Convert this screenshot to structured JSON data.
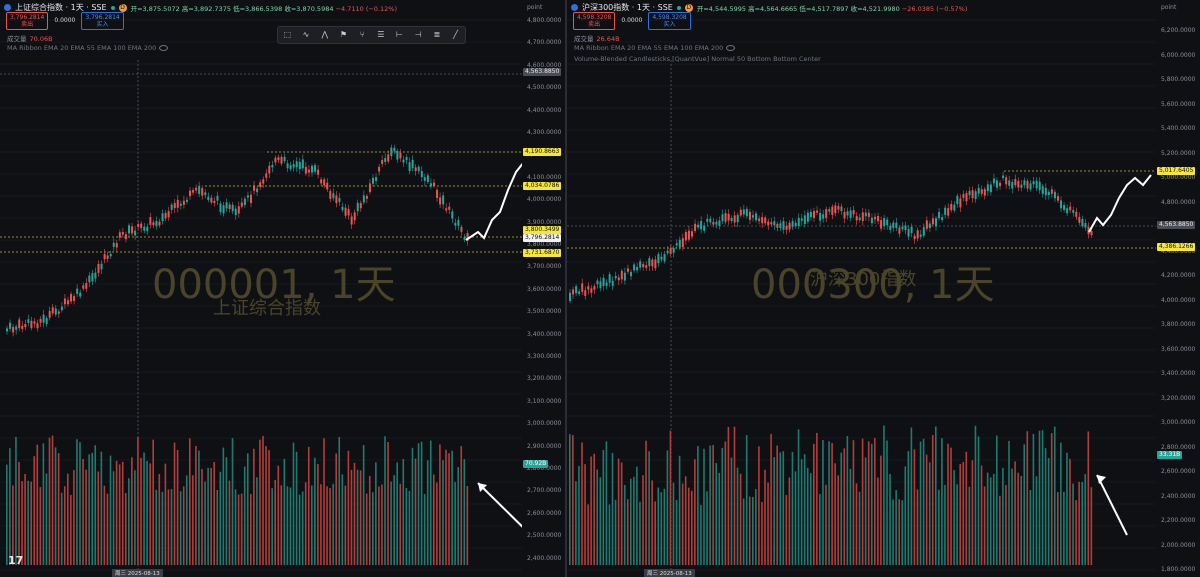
{
  "left": {
    "symbol_title": "上证综合指数 · 1天 · SSE",
    "ohlc": {
      "open": "开=3,875.5072",
      "high": "高=3,892.7375",
      "low": "低=3,866.5398",
      "close": "收=3,870.5984",
      "change": "−4.7110 (−0.12%)"
    },
    "sell_price": "3,796.2814",
    "sell_label": "卖出",
    "spread": "0.0000",
    "buy_price": "3,796.2814",
    "buy_label": "买入",
    "volume_label": "成交量",
    "volume_value": "70.06B",
    "indicator_ma": "MA Ribbon EMA 20 EMA 55 EMA 100 EMA 200",
    "watermark_symbol": "000001, 1天",
    "watermark_name": "上证综合指数",
    "axis_unit": "point",
    "axis_ticks": [
      "4,800.0000",
      "4,700.0000",
      "4,600.0000",
      "4,500.0000",
      "4,400.0000",
      "4,300.0000",
      "4,200.0000",
      "4,100.0000",
      "4,000.0000",
      "3,900.0000",
      "3,800.0000",
      "3,700.0000",
      "3,600.0000",
      "3,500.0000",
      "3,400.0000",
      "3,300.0000",
      "3,200.0000",
      "3,100.0000",
      "3,000.0000",
      "2,900.0000",
      "2,800.0000",
      "2,700.0000",
      "2,600.0000",
      "2,500.0000",
      "2,400.0000",
      "2,300.0000"
    ],
    "tags": {
      "crosshair": "4,563.8850",
      "level_high": "4,190.8663",
      "level_mid": "4,034.0786",
      "level_support": "3,800.3499",
      "last_price": "3,796.2814",
      "level_low": "3,731.6870",
      "volume": "70.92B"
    },
    "date_cursor": "周三 2025-08-13"
  },
  "right": {
    "symbol_title": "沪深300指数 · 1天 · SSE",
    "ohlc": {
      "open": "开=4,544.5995",
      "high": "高=4,564.6665",
      "low": "低=4,517.7897",
      "close": "收=4,521.9980",
      "change": "−26.0385 (−0.57%)"
    },
    "sell_price": "4,598.3208",
    "sell_label": "卖出",
    "spread": "0.0000",
    "buy_price": "4,598.3208",
    "buy_label": "买入",
    "volume_label": "成交量",
    "volume_value": "26.64B",
    "indicator_ma": "MA Ribbon EMA 20 EMA 55 EMA 100 EMA 200",
    "indicator_vbc": "Volume-Blended Candlesticks [QuantVue] Normal 50 Bottom Bottom Center",
    "watermark_symbol": "000300, 1天",
    "watermark_name": "沪深300指数",
    "axis_unit": "point",
    "axis_ticks": [
      "6,200.0000",
      "6,000.0000",
      "5,800.0000",
      "5,600.0000",
      "5,400.0000",
      "5,200.0000",
      "5,000.0000",
      "4,800.0000",
      "4,600.0000",
      "4,400.0000",
      "4,200.0000",
      "4,000.0000",
      "3,800.0000",
      "3,600.0000",
      "3,400.0000",
      "3,200.0000",
      "3,000.0000",
      "2,800.0000",
      "2,600.0000",
      "2,400.0000",
      "2,200.0000",
      "2,000.0000",
      "1,800.0000"
    ],
    "tags": {
      "level_high": "5,017.6405",
      "crosshair": "4,563.8850",
      "level_low": "4,386.1266",
      "volume": "33.31B"
    },
    "date_cursor": "周三 2025-08-13"
  },
  "colors": {
    "up": "#26a69a",
    "down": "#ef5350",
    "level": "#c8b43a",
    "projection": "#ffffff"
  }
}
